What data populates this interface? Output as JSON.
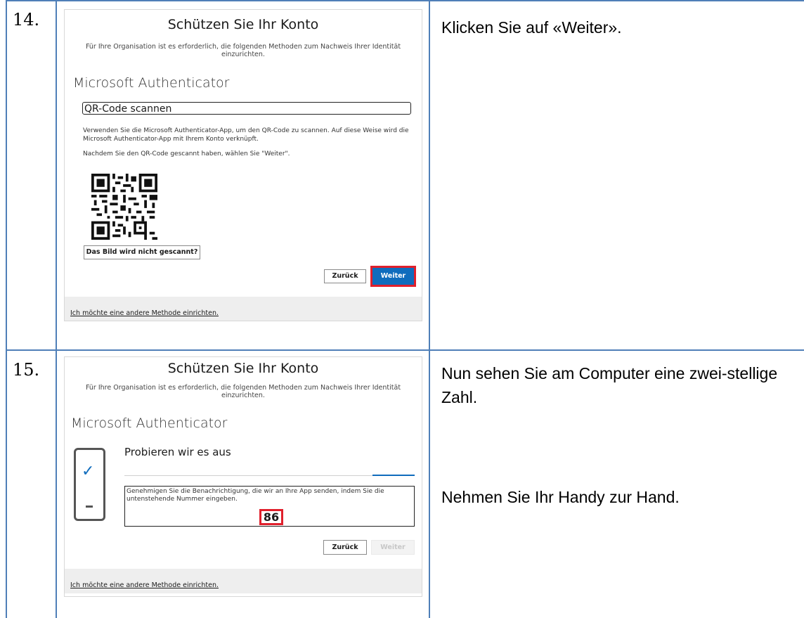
{
  "steps": [
    {
      "number": "14.",
      "instruction": "Klicken Sie auf «Weiter».",
      "screenshot": {
        "title": "Schützen Sie Ihr Konto",
        "subtitle": "Für Ihre Organisation ist es erforderlich, die folgenden Methoden zum Nachweis Ihrer Identität einzurichten.",
        "app_title": "Microsoft Authenticator",
        "section_heading": "QR-Code scannen",
        "body_1": "Verwenden Sie die Microsoft Authenticator-App, um den QR-Code zu scannen. Auf diese Weise wird die Microsoft Authenticator-App mit Ihrem Konto verknüpft.",
        "body_2": "Nachdem Sie den QR-Code gescannt haben, wählen Sie \"Weiter\".",
        "not_scanned_button": "Das Bild wird nicht gescannt?",
        "back_button": "Zurück",
        "next_button": "Weiter",
        "other_method_link": "Ich möchte eine andere Methode einrichten."
      }
    },
    {
      "number": "15.",
      "instruction_1": "Nun sehen Sie am Computer eine zwei-stellige Zahl.",
      "instruction_2": "Nehmen Sie Ihr Handy zur Hand.",
      "screenshot": {
        "title": "Schützen Sie Ihr Konto",
        "subtitle": "Für Ihre Organisation ist es erforderlich, die folgenden Methoden zum Nachweis Ihrer Identität einzurichten.",
        "app_title": "Microsoft Authenticator",
        "try_heading": "Probieren wir es aus",
        "approve_text": "Genehmigen Sie die Benachrichtigung, die wir an Ihre App senden, indem Sie die untenstehende Nummer eingeben.",
        "number": "86",
        "back_button": "Zurück",
        "next_button": "Weiter",
        "other_method_link": "Ich möchte eine andere Methode einrichten."
      }
    }
  ],
  "colors": {
    "table_border": "#4f7fb8",
    "primary": "#0f6cbd",
    "highlight": "#e0202c"
  }
}
